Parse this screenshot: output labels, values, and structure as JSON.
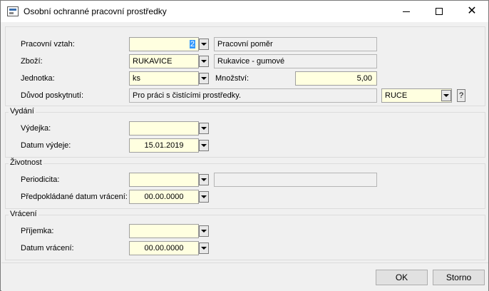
{
  "window": {
    "title": "Osobní ochranné pracovní prostředky",
    "close_glyph": "✕"
  },
  "main": {
    "pracovni_vztah": {
      "label": "Pracovní vztah:",
      "value": "2",
      "description": "Pracovní poměr"
    },
    "zbozi": {
      "label": "Zboží:",
      "value": "RUKAVICE",
      "description": "Rukavice - gumové"
    },
    "jednotka": {
      "label": "Jednotka:",
      "value": "ks"
    },
    "mnozstvi": {
      "label": "Množství:",
      "value": "5,00"
    },
    "duvod": {
      "label": "Důvod poskytnutí:",
      "value": "Pro práci s čistícími prostředky.",
      "code": "RUCE",
      "help": "?"
    }
  },
  "vydani": {
    "legend": "Vydání",
    "vydejka": {
      "label": "Výdejka:",
      "value": ""
    },
    "datum_vydeje": {
      "label": "Datum výdeje:",
      "value": "15.01.2019"
    }
  },
  "zivotnost": {
    "legend": "Životnost",
    "periodicita": {
      "label": "Periodicita:",
      "value": "",
      "description": ""
    },
    "predpokladane_datum": {
      "label": "Předpokládané datum vrácení:",
      "value": "00.00.0000"
    }
  },
  "vraceni": {
    "legend": "Vrácení",
    "prijemka": {
      "label": "Příjemka:",
      "value": ""
    },
    "datum_vraceni": {
      "label": "Datum vrácení:",
      "value": "00.00.0000"
    }
  },
  "footer": {
    "ok_label": "OK",
    "cancel_label": "Storno"
  },
  "icons": {
    "app": "app-icon",
    "dropdown": "chevron-down-icon"
  }
}
